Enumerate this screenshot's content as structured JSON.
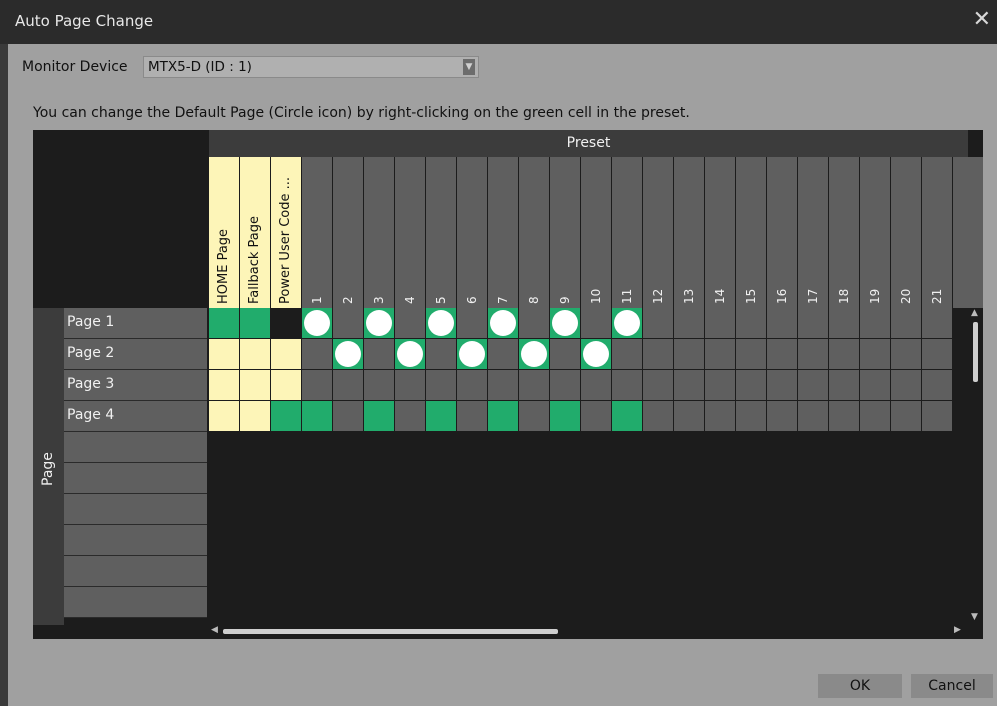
{
  "window": {
    "title": "Auto Page Change",
    "close_glyph": "✕"
  },
  "monitor": {
    "label": "Monitor Device",
    "value": "MTX5-D (ID : 1)",
    "arrow": "▼"
  },
  "hint": "You can change the Default Page (Circle icon) by right-clicking on the green cell in the preset.",
  "grid": {
    "preset_header": "Preset",
    "page_header": "Page",
    "special_columns": [
      "HOME Page",
      "Fallback Page",
      "Power User Code ..."
    ],
    "preset_numbers": [
      "1",
      "2",
      "3",
      "4",
      "5",
      "6",
      "7",
      "8",
      "9",
      "10",
      "11",
      "12",
      "13",
      "14",
      "15",
      "16",
      "17",
      "18",
      "19",
      "20",
      "21"
    ],
    "pages": [
      "Page 1",
      "Page 2",
      "Page 3",
      "Page 4"
    ],
    "empty_rows": 6,
    "cells": [
      [
        "g",
        "g",
        "k",
        "gD",
        "n",
        "gD",
        "n",
        "gD",
        "n",
        "gD",
        "n",
        "gD",
        "n",
        "gD",
        "n",
        "n",
        "n",
        "n",
        "n",
        "n",
        "n",
        "n",
        "n",
        "n"
      ],
      [
        "y",
        "y",
        "y",
        "n",
        "gD",
        "n",
        "gD",
        "n",
        "gD",
        "n",
        "gD",
        "n",
        "gD",
        "n",
        "n",
        "n",
        "n",
        "n",
        "n",
        "n",
        "n",
        "n",
        "n",
        "n"
      ],
      [
        "y",
        "y",
        "y",
        "n",
        "n",
        "n",
        "n",
        "n",
        "n",
        "n",
        "n",
        "n",
        "n",
        "n",
        "n",
        "n",
        "n",
        "n",
        "n",
        "n",
        "n",
        "n",
        "n",
        "n"
      ],
      [
        "y",
        "y",
        "g",
        "g",
        "n",
        "g",
        "n",
        "g",
        "n",
        "g",
        "n",
        "g",
        "n",
        "g",
        "n",
        "n",
        "n",
        "n",
        "n",
        "n",
        "n",
        "n",
        "n",
        "n"
      ]
    ],
    "legend": {
      "g": "green cell (preset)",
      "gD": "green cell with default page circle",
      "y": "special column cell",
      "n": "unassigned cell",
      "k": "disabled cell"
    }
  },
  "buttons": {
    "ok": "OK",
    "cancel": "Cancel"
  },
  "colors": {
    "green": "#21ac6c",
    "yellow": "#fdf5b8",
    "gray": "#5f5f5f",
    "dark": "#1c1c1c",
    "header": "#3c3c3c"
  }
}
